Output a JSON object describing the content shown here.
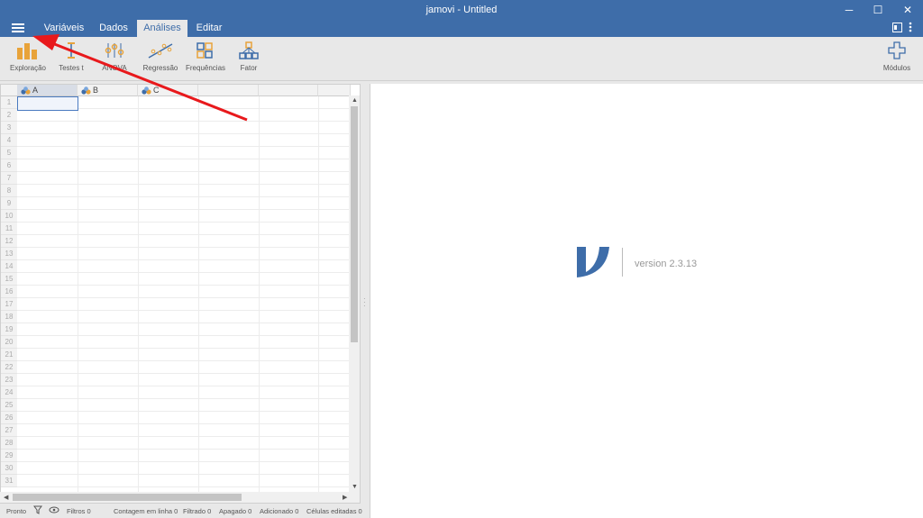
{
  "window": {
    "title": "jamovi - Untitled",
    "minimize": "─",
    "maximize": "☐",
    "close": "✕"
  },
  "tabs": [
    {
      "label": "Variáveis"
    },
    {
      "label": "Dados"
    },
    {
      "label": "Análises",
      "active": true
    },
    {
      "label": "Editar"
    }
  ],
  "ribbon": {
    "buttons": [
      {
        "label": "Exploração",
        "icon": "exploration-icon"
      },
      {
        "label": "Testes t",
        "icon": "ttest-icon"
      },
      {
        "label": "ANOVA",
        "icon": "anova-icon"
      },
      {
        "label": "Regressão",
        "icon": "regression-icon"
      },
      {
        "label": "Frequências",
        "icon": "frequencies-icon"
      },
      {
        "label": "Fator",
        "icon": "factor-icon"
      }
    ],
    "modules_label": "Módulos"
  },
  "spreadsheet": {
    "columns": [
      "A",
      "B",
      "C"
    ],
    "rows": [
      "1",
      "2",
      "3",
      "4",
      "5",
      "6",
      "7",
      "8",
      "9",
      "10",
      "11",
      "12",
      "13",
      "14",
      "15",
      "16",
      "17",
      "18",
      "19",
      "20",
      "21",
      "22",
      "23",
      "24",
      "25",
      "26",
      "27",
      "28",
      "29",
      "30",
      "31"
    ]
  },
  "status": {
    "ready": "Pronto",
    "filters": "Filtros 0",
    "row_count": "Contagem em linha 0",
    "filtered": "Filtrado 0",
    "deleted": "Apagado 0",
    "added": "Adicionado 0",
    "edited": "Células editadas 0"
  },
  "results": {
    "version": "version 2.3.13"
  },
  "colors": {
    "accent": "#3e6da9",
    "ribbon_orange": "#e8a33a",
    "annotation_arrow": "#e8191c"
  }
}
